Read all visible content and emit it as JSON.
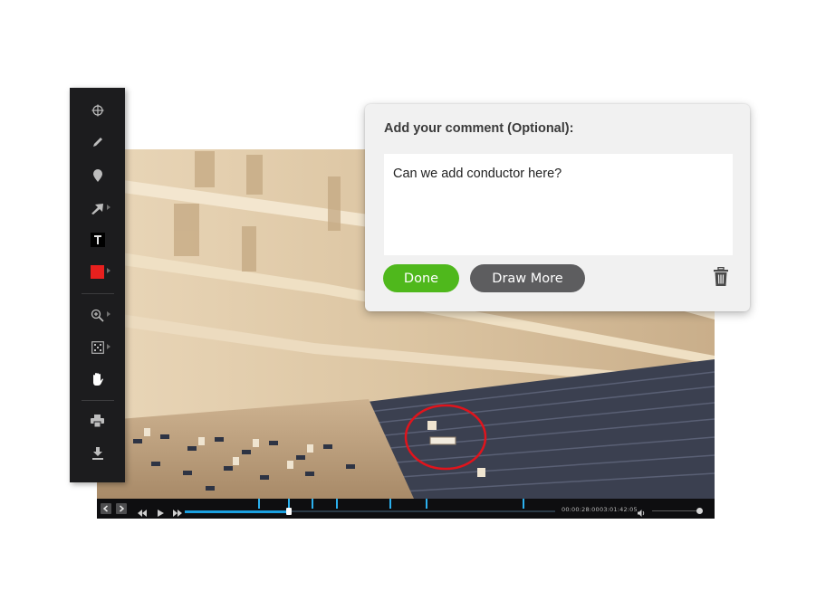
{
  "toolbar": {
    "tools": [
      {
        "name": "crosshair-icon"
      },
      {
        "name": "pencil-icon"
      },
      {
        "name": "map-pin-icon"
      },
      {
        "name": "arrow-icon",
        "flyout": true
      },
      {
        "name": "text-tool-icon",
        "glyph": "T"
      },
      {
        "name": "color-swatch-icon",
        "flyout": true,
        "color": "#e8201e"
      },
      {
        "name": "zoom-icon",
        "flyout": true
      },
      {
        "name": "fit-screen-icon",
        "flyout": true
      },
      {
        "name": "hand-icon",
        "active": true
      },
      {
        "name": "print-icon"
      },
      {
        "name": "download-icon"
      }
    ]
  },
  "comment": {
    "title": "Add your comment (Optional):",
    "text": "Can we add conductor here?",
    "done_label": "Done",
    "draw_more_label": "Draw More"
  },
  "player": {
    "current_time": "00:00:28:00",
    "total_time": "03:01:42:05",
    "progress_fraction": 0.28,
    "volume_fraction": 0.93
  },
  "colors": {
    "accent_done": "#4fb81c",
    "timeline": "#1aa0e0",
    "annotation_circle": "#e0141c"
  }
}
